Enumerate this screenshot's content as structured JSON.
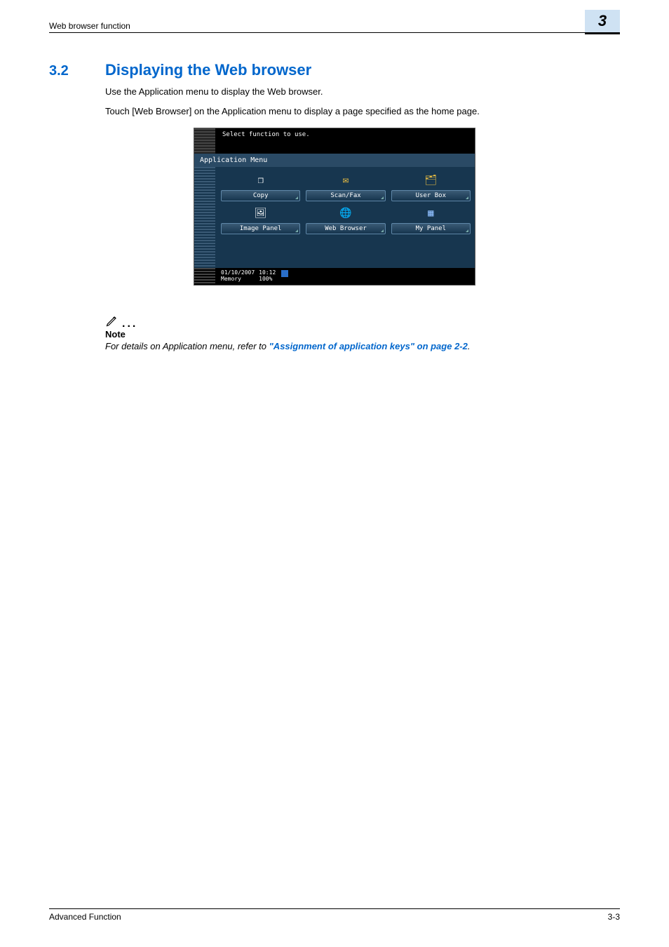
{
  "header": {
    "running_title": "Web browser function",
    "chapter_number": "3"
  },
  "section": {
    "number": "3.2",
    "title": "Displaying the Web browser",
    "para1": "Use the Application menu to display the Web browser.",
    "para2": "Touch [Web Browser] on the Application menu to display a page specified as the home page."
  },
  "screenshot": {
    "top_message": "Select function to use.",
    "panel_title": "Application Menu",
    "items": [
      {
        "label": "Copy",
        "icon": "copy-icon",
        "glyph": "❐"
      },
      {
        "label": "Scan/Fax",
        "icon": "scanfax-icon",
        "glyph": "✉"
      },
      {
        "label": "User Box",
        "icon": "userbox-icon",
        "glyph": "🗂"
      },
      {
        "label": "Image Panel",
        "icon": "imgpanel-icon",
        "glyph": "🖼"
      },
      {
        "label": "Web Browser",
        "icon": "web-icon",
        "glyph": "🌐"
      },
      {
        "label": "My Panel",
        "icon": "mypanel-icon",
        "glyph": "▦"
      }
    ],
    "footer": {
      "date": "01/10/2007",
      "memory_label": "Memory",
      "time": "10:12",
      "memory_value": "100%"
    }
  },
  "note": {
    "label": "Note",
    "lead_text": "For details on Application menu, refer to ",
    "link_text": "\"Assignment of application keys\" on page 2-2",
    "trail_text": "."
  },
  "footer": {
    "doc_title": "Advanced Function",
    "page_number": "3-3"
  }
}
